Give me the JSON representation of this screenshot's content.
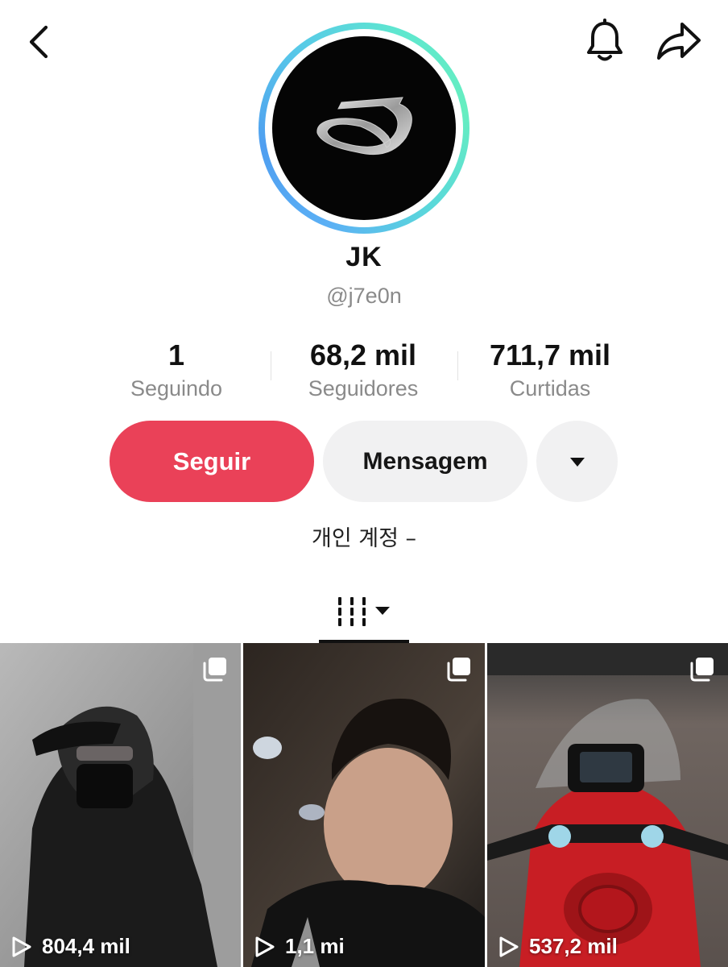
{
  "profile": {
    "display_name": "JK",
    "username": "@j7e0n",
    "bio": "개인 계정 –"
  },
  "stats": {
    "following": {
      "value": "1",
      "label": "Seguindo"
    },
    "followers": {
      "value": "68,2 mil",
      "label": "Seguidores"
    },
    "likes": {
      "value": "711,7 mil",
      "label": "Curtidas"
    }
  },
  "actions": {
    "follow_label": "Seguir",
    "message_label": "Mensagem"
  },
  "icons": {
    "back": "chevron-left-icon",
    "notifications": "bell-icon",
    "share": "share-arrow-icon",
    "more": "caret-down-icon",
    "videos_tab": "grid-lines-icon",
    "tile_multi": "multi-photo-icon",
    "tile_views": "play-icon"
  },
  "colors": {
    "follow_button": "#ea4158",
    "ring_gradient": [
      "#4f9ef0",
      "#66eec0"
    ],
    "muted_text": "#8a8a8a"
  },
  "videos": [
    {
      "views": "804,4 mil"
    },
    {
      "views": "1,1 mi"
    },
    {
      "views": "537,2 mil"
    }
  ]
}
